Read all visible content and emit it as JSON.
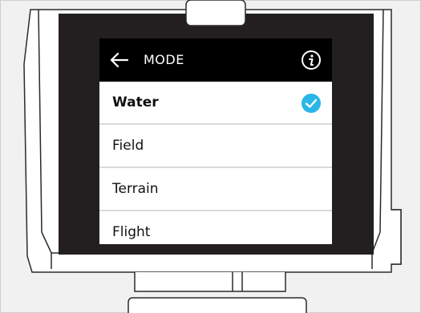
{
  "header": {
    "title": "MODE"
  },
  "modes": [
    {
      "label": "Water",
      "selected": true
    },
    {
      "label": "Field",
      "selected": false
    },
    {
      "label": "Terrain",
      "selected": false
    },
    {
      "label": "Flight",
      "selected": false
    }
  ],
  "colors": {
    "header_bg": "#000000",
    "bezel": "#231f20",
    "check_accent": "#29b6e8",
    "divider": "#d9d9d9"
  },
  "icons": {
    "back": "arrow-left-icon",
    "info": "info-icon",
    "selected": "check-circle-icon"
  }
}
